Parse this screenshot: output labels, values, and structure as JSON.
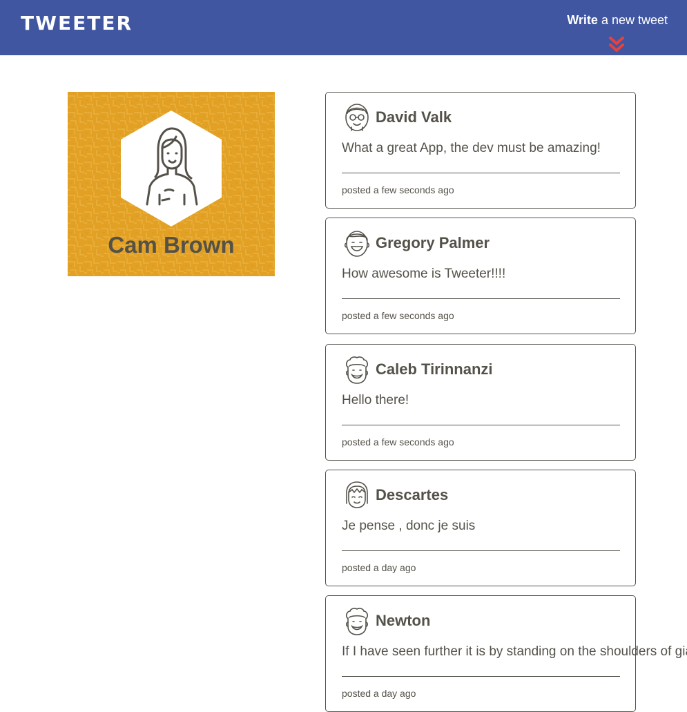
{
  "nav": {
    "logo": "TWEETER",
    "compose_bold": "Write",
    "compose_rest": " a new tweet",
    "accent_color": "#E8413D",
    "background_color": "#4056A1"
  },
  "profile": {
    "name": "Cam Brown",
    "avatar_icon": "woman-avatar-icon",
    "background_color": "#E2A124"
  },
  "tweets": [
    {
      "name": "David Valk",
      "avatar_icon": "glasses-man-avatar-icon",
      "content": "What a great App, the dev must be amazing!",
      "meta": "posted a few seconds ago"
    },
    {
      "name": "Gregory Palmer",
      "avatar_icon": "smiling-man-avatar-icon",
      "content": "How awesome is Tweeter!!!!",
      "meta": "posted a few seconds ago"
    },
    {
      "name": "Caleb Tirinnanzi",
      "avatar_icon": "curly-hair-avatar-icon",
      "content": "Hello there!",
      "meta": "posted a few seconds ago"
    },
    {
      "name": "Descartes",
      "avatar_icon": "bangs-avatar-icon",
      "content": "Je pense , donc je suis",
      "meta": "posted a day ago"
    },
    {
      "name": "Newton",
      "avatar_icon": "curly-hair-avatar-icon",
      "content": "If I have seen further it is by standing on the shoulders of giants",
      "meta": "posted a day ago"
    }
  ]
}
